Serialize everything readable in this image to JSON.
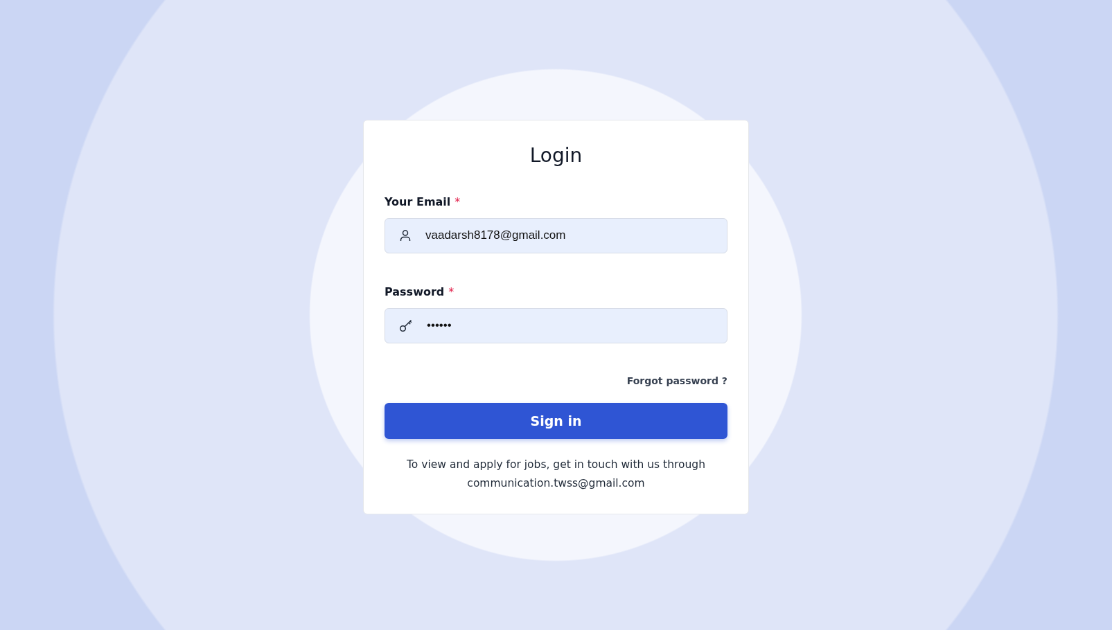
{
  "title": "Login",
  "fields": [
    {
      "kind": "email",
      "label": "Your Email",
      "required_mark": "*",
      "value": "vaadarsh8178@gmail.com"
    },
    {
      "kind": "password",
      "label": "Password",
      "required_mark": "*",
      "value": "••••••"
    }
  ],
  "forgot_link": "Forgot password ?",
  "submit_button": "Sign in",
  "footer_note": "To view and apply for jobs, get in touch with us through communication.twss@gmail.com"
}
